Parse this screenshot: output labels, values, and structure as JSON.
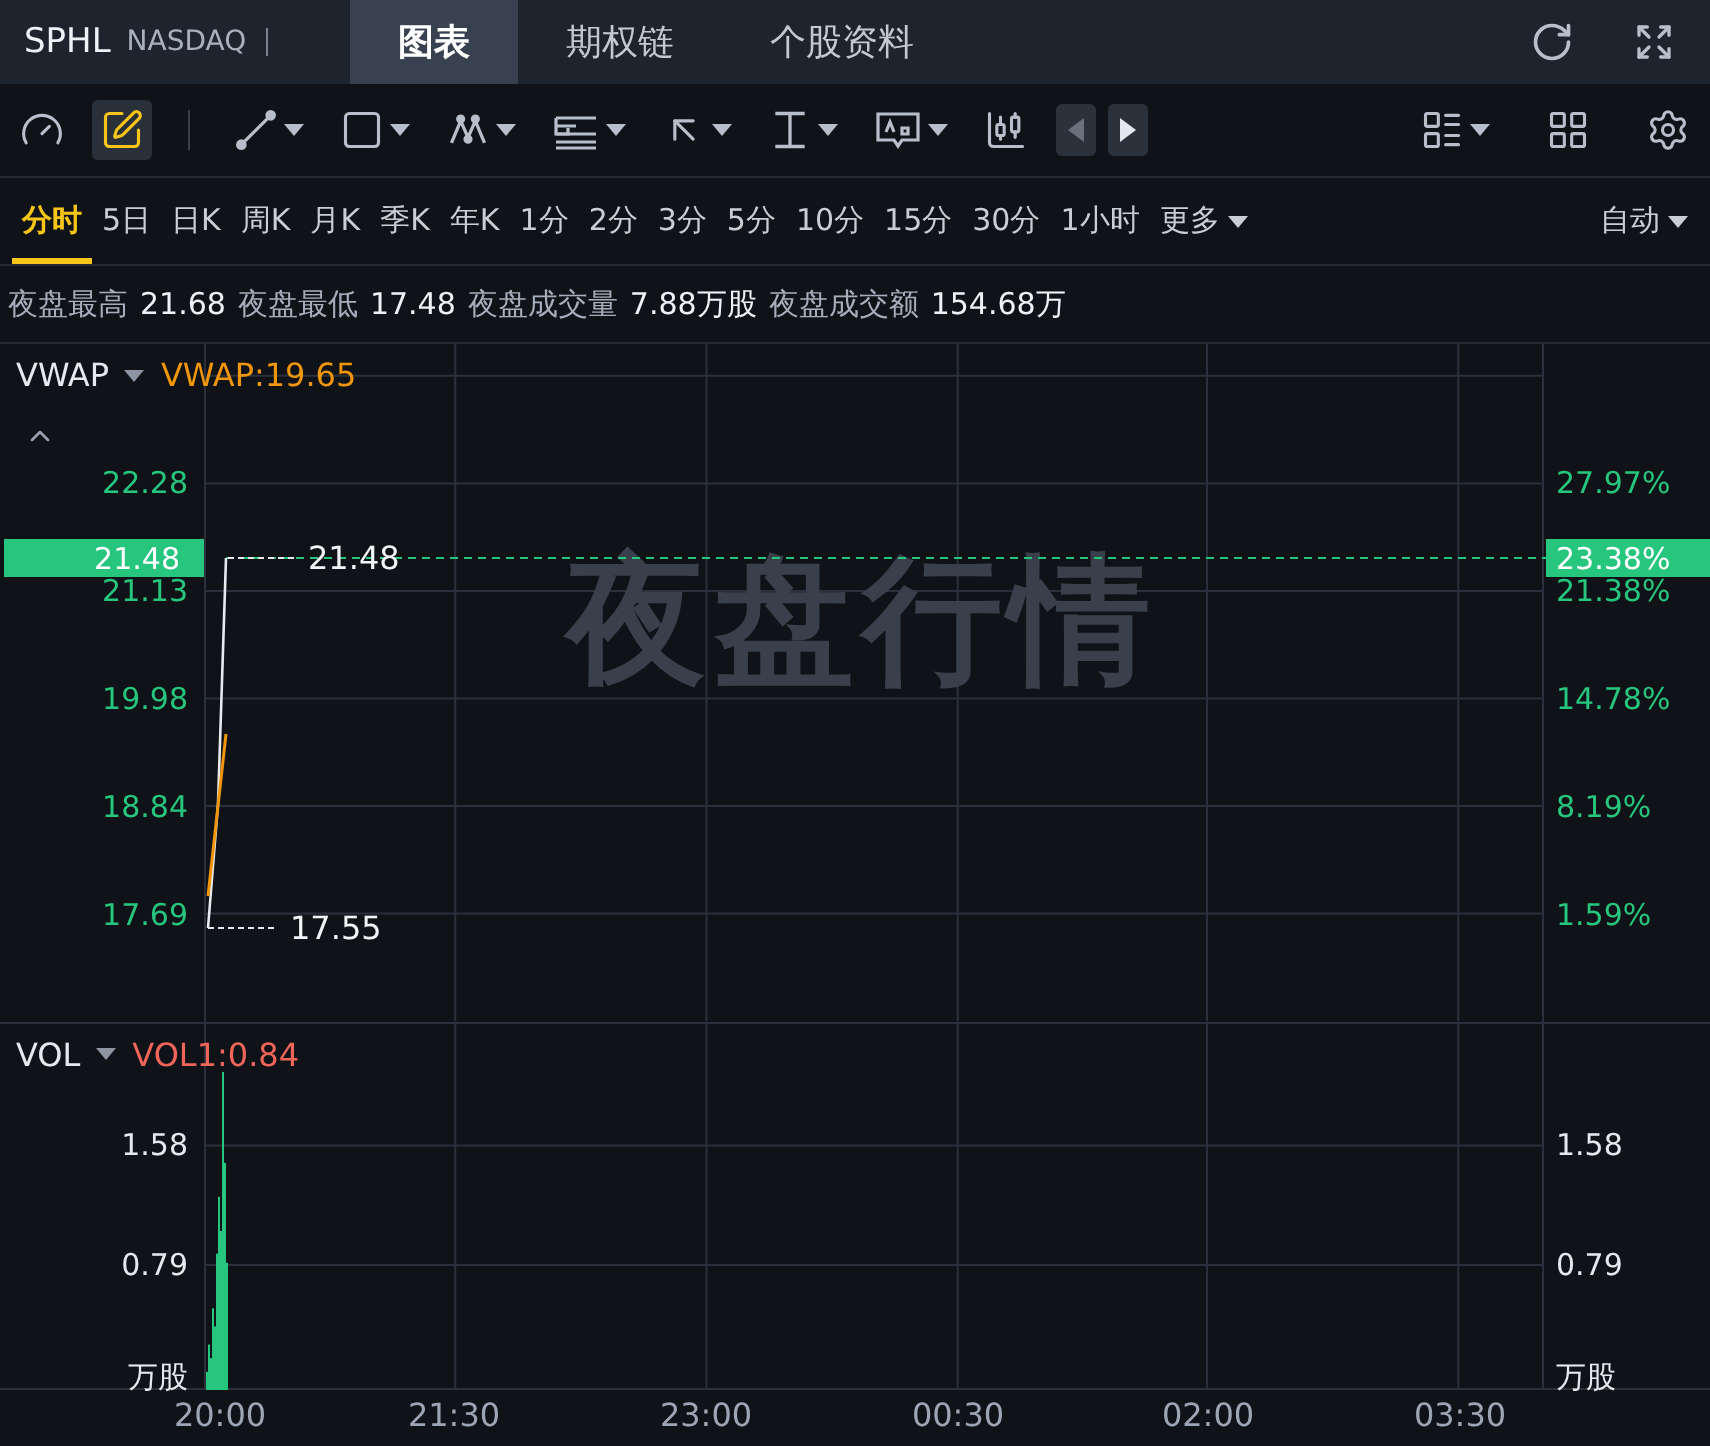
{
  "header": {
    "symbol": "SPHL",
    "exchange": "NASDAQ",
    "tabs": [
      {
        "label": "图表",
        "selected": true
      },
      {
        "label": "期权链",
        "selected": false
      },
      {
        "label": "个股资料",
        "selected": false
      }
    ]
  },
  "toolbar": {
    "tools": [
      {
        "kind": "gauge",
        "selected": false,
        "dropdown": false
      },
      {
        "kind": "pencil",
        "selected": true,
        "dropdown": false
      },
      {
        "kind": "line",
        "selected": false,
        "dropdown": true
      },
      {
        "kind": "rectangle",
        "selected": false,
        "dropdown": true
      },
      {
        "kind": "pattern",
        "selected": false,
        "dropdown": true
      },
      {
        "kind": "fib",
        "selected": false,
        "dropdown": true
      },
      {
        "kind": "arrow",
        "selected": false,
        "dropdown": true
      },
      {
        "kind": "measure",
        "selected": false,
        "dropdown": true
      },
      {
        "kind": "note",
        "selected": false,
        "dropdown": true
      },
      {
        "kind": "candles",
        "selected": false,
        "dropdown": false
      }
    ],
    "nav": [
      {
        "kind": "prev",
        "disabled": true
      },
      {
        "kind": "next",
        "disabled": false
      }
    ],
    "right": [
      {
        "kind": "layout",
        "dropdown": true
      },
      {
        "kind": "grid",
        "dropdown": false
      },
      {
        "kind": "settings",
        "dropdown": false
      }
    ]
  },
  "periods": [
    {
      "label": "分时",
      "selected": true
    },
    {
      "label": "5日",
      "selected": false
    },
    {
      "label": "日K",
      "selected": false
    },
    {
      "label": "周K",
      "selected": false
    },
    {
      "label": "月K",
      "selected": false
    },
    {
      "label": "季K",
      "selected": false
    },
    {
      "label": "年K",
      "selected": false
    },
    {
      "label": "1分",
      "selected": false
    },
    {
      "label": "2分",
      "selected": false
    },
    {
      "label": "3分",
      "selected": false
    },
    {
      "label": "5分",
      "selected": false
    },
    {
      "label": "10分",
      "selected": false
    },
    {
      "label": "15分",
      "selected": false
    },
    {
      "label": "30分",
      "selected": false
    },
    {
      "label": "1小时",
      "selected": false
    },
    {
      "label": "更多",
      "selected": false,
      "dropdown": true
    }
  ],
  "scale_mode": "自动",
  "stats": [
    {
      "label": "夜盘最高",
      "value": "21.68"
    },
    {
      "label": "夜盘最低",
      "value": "17.48"
    },
    {
      "label": "夜盘成交量",
      "value": "7.88万股"
    },
    {
      "label": "夜盘成交额",
      "value": "154.68万"
    }
  ],
  "price_pane": {
    "indicator": "VWAP",
    "legend": "VWAP:19.65",
    "watermark": "夜盘行情",
    "left_ticks": [
      "22.28",
      "21.13",
      "19.98",
      "18.84",
      "17.69"
    ],
    "right_ticks": [
      "27.97%",
      "21.38%",
      "14.78%",
      "8.19%",
      "1.59%"
    ],
    "current_price": "21.48",
    "current_change": "23.38%",
    "high_label": "21.48",
    "low_label": "17.55"
  },
  "volume_pane": {
    "indicator": "VOL",
    "legend": "VOL1:0.84",
    "left_ticks": [
      "1.58",
      "0.79",
      "万股"
    ],
    "right_ticks": [
      "1.58",
      "0.79",
      "万股"
    ]
  },
  "time_axis": [
    "20:00",
    "21:30",
    "23:00",
    "00:30",
    "02:00",
    "03:30"
  ]
}
